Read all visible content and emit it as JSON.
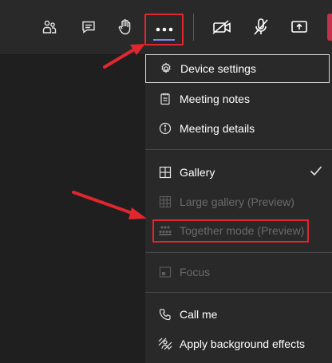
{
  "toolbar": {
    "icons": [
      "people-icon",
      "chat-icon",
      "raise-hand-icon",
      "more-options-icon",
      "camera-off-icon",
      "mic-off-icon",
      "share-screen-icon",
      "leave-button"
    ]
  },
  "menu": {
    "device_settings": "Device settings",
    "meeting_notes": "Meeting notes",
    "meeting_details": "Meeting details",
    "gallery": "Gallery",
    "large_gallery": "Large gallery (Preview)",
    "together_mode": "Together mode (Preview)",
    "focus": "Focus",
    "call_me": "Call me",
    "apply_background": "Apply background effects"
  },
  "colors": {
    "annotation_red": "#e0262e",
    "accent": "#7f85f5",
    "menu_bg": "#292929",
    "leave_red": "#c4314b"
  }
}
